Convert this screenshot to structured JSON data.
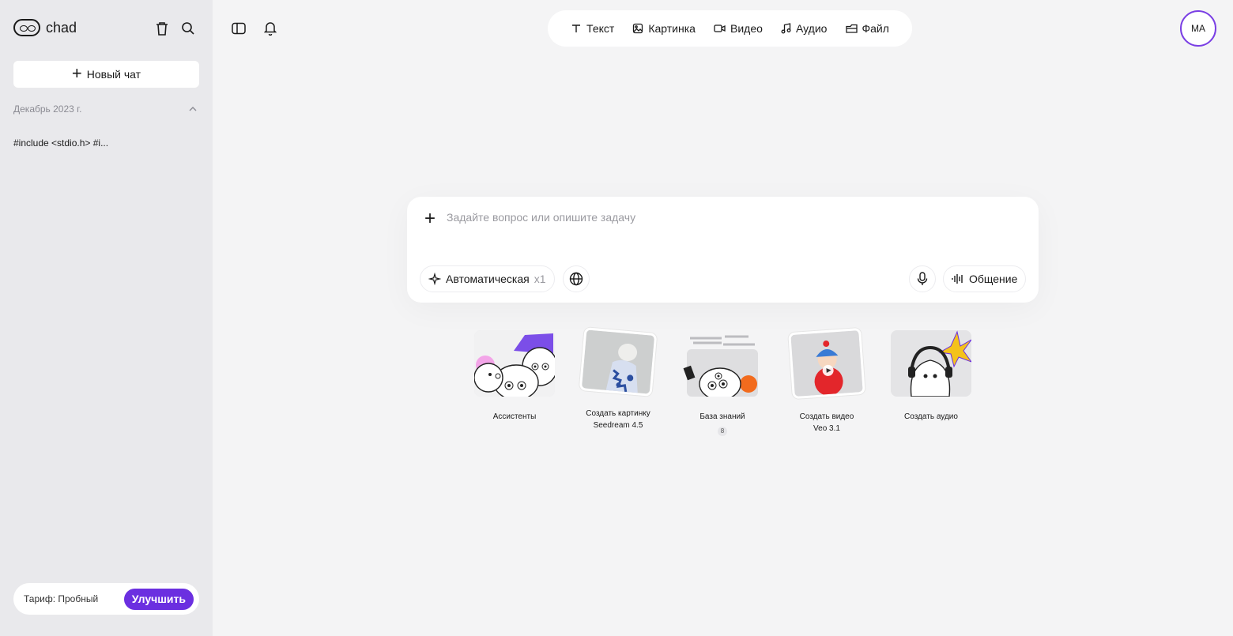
{
  "sidebar": {
    "logo_text": "chad",
    "new_chat_label": "Новый чат",
    "section_title": "Декабрь 2023 г.",
    "chats": [
      "#include <stdio.h> #i..."
    ],
    "plan_label": "Тариф: Пробный",
    "upgrade_label": "Улучшить"
  },
  "topbar": {
    "modes": [
      {
        "label": "Текст",
        "icon": "text-icon"
      },
      {
        "label": "Картинка",
        "icon": "image-icon"
      },
      {
        "label": "Видео",
        "icon": "video-icon"
      },
      {
        "label": "Аудио",
        "icon": "music-icon"
      },
      {
        "label": "Файл",
        "icon": "file-icon"
      }
    ],
    "avatar_initials": "MA"
  },
  "composer": {
    "placeholder": "Задайте вопрос или опишите задачу",
    "value": "",
    "model_label": "Автоматическая",
    "model_multiplier": "x1",
    "voice_label": "Общение"
  },
  "cards": [
    {
      "label": "Ассистенты",
      "sub": ""
    },
    {
      "label": "Создать картинку",
      "sub": "Seedream 4.5"
    },
    {
      "label": "База знаний",
      "badge": "8"
    },
    {
      "label": "Создать видео",
      "sub": "Veo 3.1"
    },
    {
      "label": "Создать аудио",
      "sub": ""
    }
  ],
  "colors": {
    "accent": "#6b2fe0",
    "avatar_ring": "#7a3fe4",
    "sidebar_bg": "#e9e9ec",
    "main_bg": "#f4f4f5"
  }
}
